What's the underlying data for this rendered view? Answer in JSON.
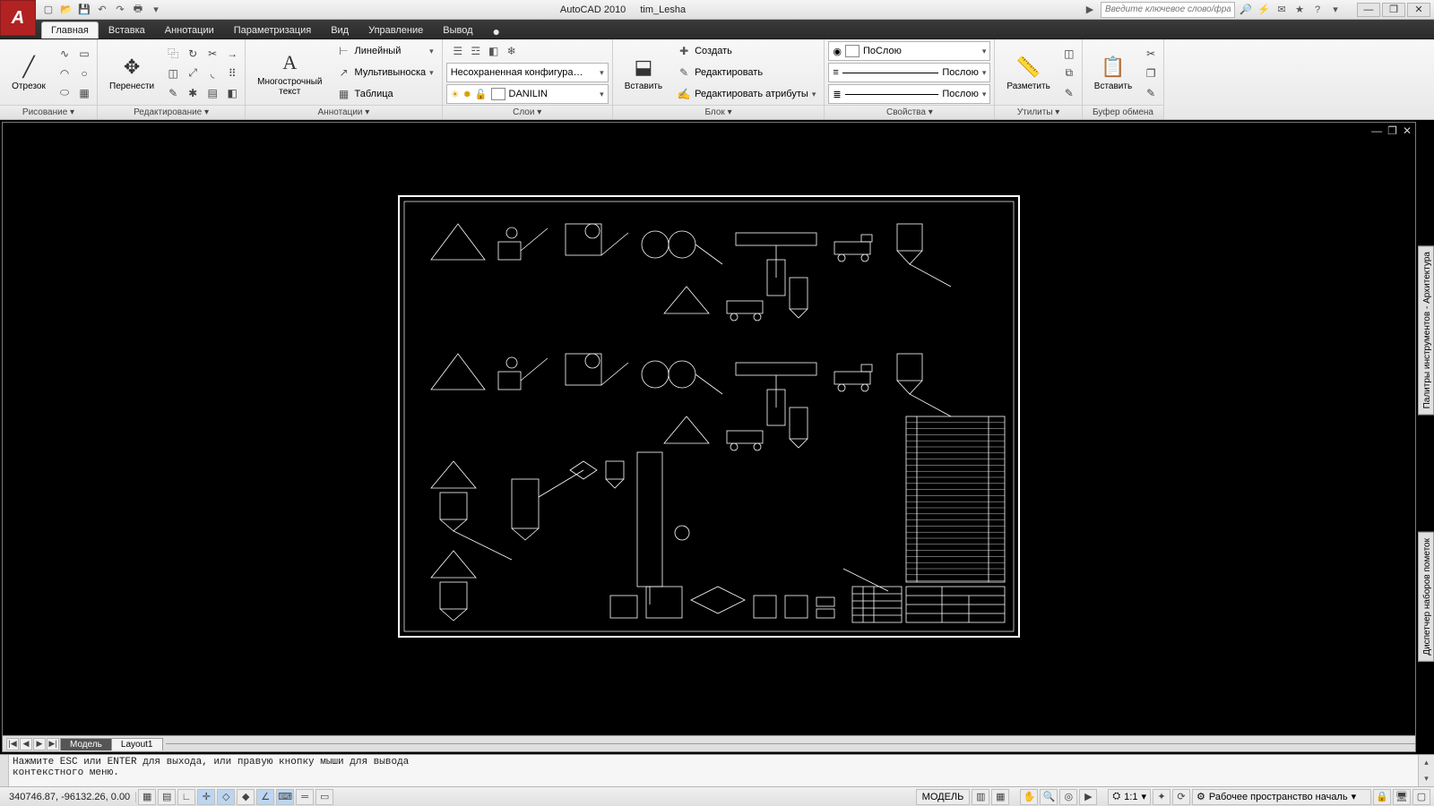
{
  "title": {
    "app": "AutoCAD 2010",
    "doc": "tim_Lesha"
  },
  "search": {
    "placeholder": "Введите ключевое слово/фразу",
    "play": "▶"
  },
  "tabs": {
    "items": [
      "Главная",
      "Вставка",
      "Аннотации",
      "Параметризация",
      "Вид",
      "Управление",
      "Вывод"
    ],
    "active": 0,
    "extra": "●"
  },
  "ribbon": {
    "draw": {
      "big": "Отрезок",
      "title": "Рисование ▾"
    },
    "edit": {
      "big": "Перенести",
      "title": "Редактирование ▾"
    },
    "annot": {
      "big": "Многострочный\nтекст",
      "items": [
        "Линейный",
        "Мультивыноска",
        "Таблица"
      ],
      "title": "Аннотации ▾"
    },
    "layers": {
      "combo1": "Несохраненная конфигурация сл",
      "combo2": "DANILIN",
      "title": "Слои ▾"
    },
    "block": {
      "big": "Вставить",
      "items": [
        "Создать",
        "Редактировать",
        "Редактировать атрибуты"
      ],
      "title": "Блок ▾"
    },
    "props": {
      "combo1": "ПоСлою",
      "combo2": "Послою",
      "combo3": "Послою",
      "title": "Свойства ▾"
    },
    "utils": {
      "big": "Разметить",
      "title": "Утилиты ▾"
    },
    "clip": {
      "big": "Вставить",
      "title": "Буфер обмена"
    }
  },
  "docwin": {
    "min": "—",
    "max": "❐",
    "close": "✕"
  },
  "doctabs": {
    "ctrls": [
      "|◀",
      "◀",
      "▶",
      "▶|"
    ],
    "items": [
      "Модель",
      "Layout1"
    ],
    "active": 0
  },
  "sidebars": [
    "Палитры инструментов - Архитектура",
    "Диспетчер наборов пометок"
  ],
  "cmdline": "Нажмите ESC или ENTER для выхода, или правую кнопку мыши для вывода\nконтекстного меню.",
  "status": {
    "coords": "340746.87, -96132.26, 0.00",
    "model": "МОДЕЛЬ",
    "scale": "1:1",
    "workspace": "Рабочее пространство началь"
  }
}
